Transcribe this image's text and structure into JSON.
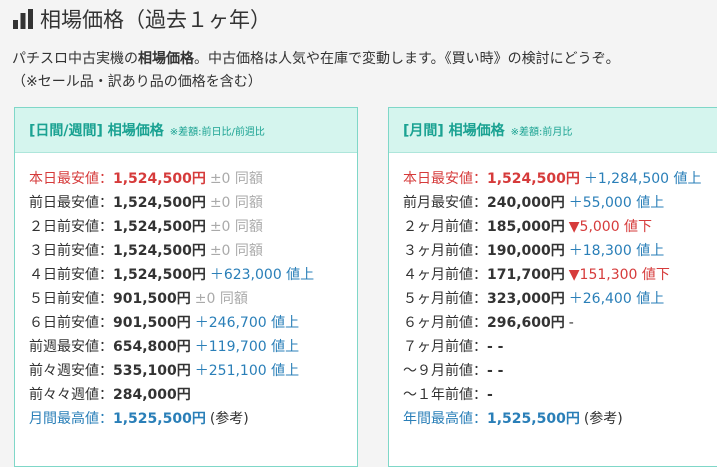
{
  "title": "相場価格（過去１ヶ年）",
  "description": {
    "part1": "パチスロ中古実機の",
    "bold": "相場価格",
    "part2": "。中古価格は人気や在庫で変動します。《買い時》の検討にどうぞ。",
    "line2": "（※セール品・訳あり品の価格を含む）"
  },
  "left_card": {
    "title": "[日間/週間] 相場価格",
    "note": "※差額:前日比/前週比",
    "rows": [
      {
        "label": "本日最安値：",
        "value": "1,524,500円",
        "diff": "±0 同額",
        "style": "red",
        "dtype": "same"
      },
      {
        "label": "前日最安値：",
        "value": "1,524,500円",
        "diff": "±0 同額",
        "style": "",
        "dtype": "same"
      },
      {
        "label": "２日前安値：",
        "value": "1,524,500円",
        "diff": "±0 同額",
        "style": "",
        "dtype": "same"
      },
      {
        "label": "３日前安値：",
        "value": "1,524,500円",
        "diff": "±0 同額",
        "style": "",
        "dtype": "same"
      },
      {
        "label": "４日前安値：",
        "value": "1,524,500円",
        "diff": "＋623,000 値上",
        "style": "",
        "dtype": "up"
      },
      {
        "label": "５日前安値：",
        "value": "901,500円",
        "diff": "±0 同額",
        "style": "",
        "dtype": "same"
      },
      {
        "label": "６日前安値：",
        "value": "901,500円",
        "diff": "＋246,700 値上",
        "style": "",
        "dtype": "up"
      },
      {
        "label": "前週最安値：",
        "value": "654,800円",
        "diff": "＋119,700 値上",
        "style": "",
        "dtype": "up"
      },
      {
        "label": "前々週安値：",
        "value": "535,100円",
        "diff": "＋251,100 値上",
        "style": "",
        "dtype": "up"
      },
      {
        "label": "前々々週値：",
        "value": "284,000円",
        "diff": "",
        "style": "",
        "dtype": "plain"
      },
      {
        "label": "月間最高値：",
        "value": "1,525,500円",
        "diff": "(参考)",
        "style": "blue",
        "dtype": "plain"
      }
    ]
  },
  "right_card": {
    "title": "[月間] 相場価格",
    "note": "※差額:前月比",
    "rows": [
      {
        "label": "本日最安値：",
        "value": "1,524,500円",
        "diff": "＋1,284,500 値上",
        "style": "red",
        "dtype": "up"
      },
      {
        "label": "前月最安値：",
        "value": "240,000円",
        "diff": "＋55,000 値上",
        "style": "",
        "dtype": "up"
      },
      {
        "label": "２ヶ月前値：",
        "value": "185,000円",
        "diff": "▼5,000 値下",
        "style": "",
        "dtype": "down"
      },
      {
        "label": "３ヶ月前値：",
        "value": "190,000円",
        "diff": "＋18,300 値上",
        "style": "",
        "dtype": "up"
      },
      {
        "label": "４ヶ月前値：",
        "value": "171,700円",
        "diff": "▼151,300 値下",
        "style": "",
        "dtype": "down"
      },
      {
        "label": "５ヶ月前値：",
        "value": "323,000円",
        "diff": "＋26,400 値上",
        "style": "",
        "dtype": "up"
      },
      {
        "label": "６ヶ月前値：",
        "value": "296,600円",
        "diff": "-",
        "style": "",
        "dtype": "plain"
      },
      {
        "label": "７ヶ月前値：",
        "value": "- -",
        "diff": "",
        "style": "",
        "dtype": "plain"
      },
      {
        "label": "～９月前値：",
        "value": "- -",
        "diff": "",
        "style": "",
        "dtype": "plain"
      },
      {
        "label": "～１年前値：",
        "value": "-",
        "diff": "",
        "style": "",
        "dtype": "plain"
      },
      {
        "label": "年間最高値：",
        "value": "1,525,500円",
        "diff": "(参考)",
        "style": "blue",
        "dtype": "plain"
      }
    ]
  }
}
